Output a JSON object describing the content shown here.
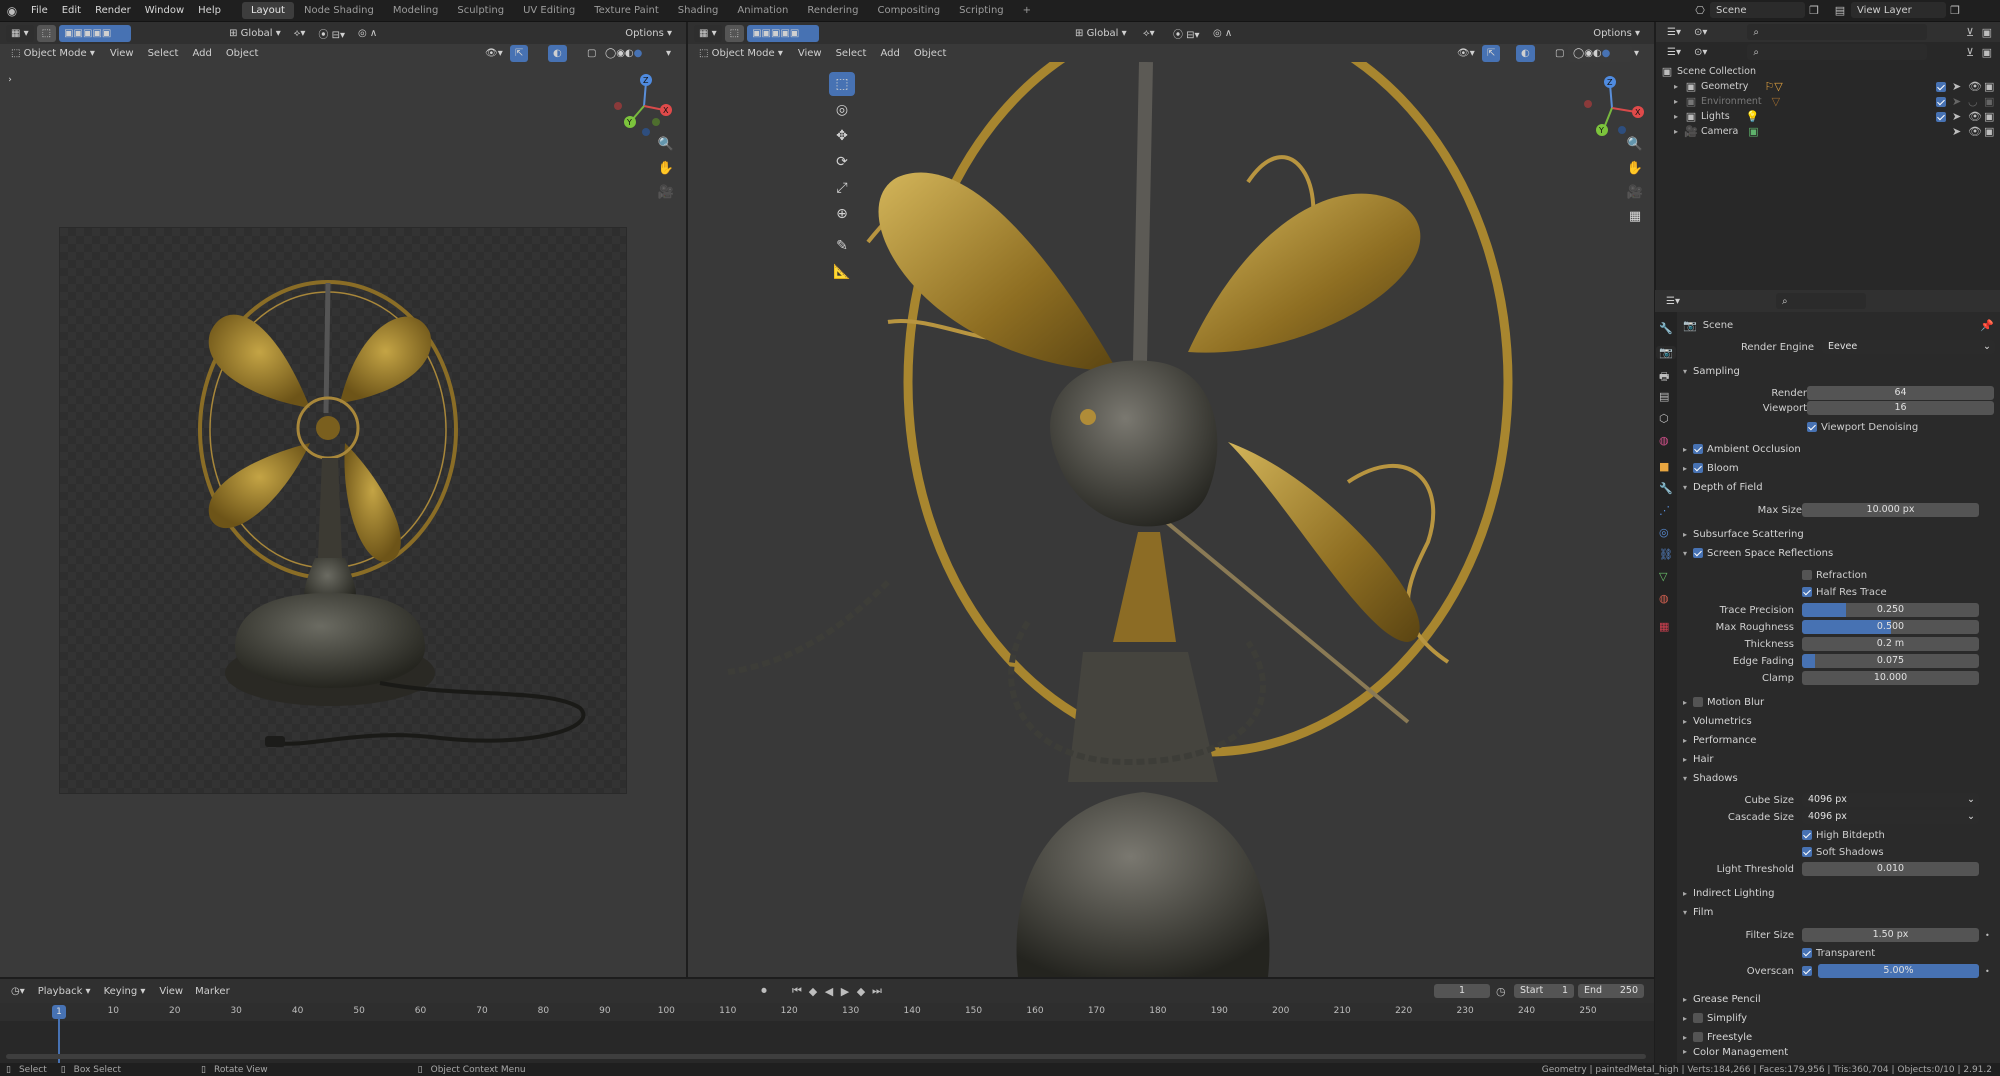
{
  "topbar": {
    "menus": [
      "File",
      "Edit",
      "Render",
      "Window",
      "Help"
    ],
    "workspaces": [
      "Layout",
      "Node Shading",
      "Modeling",
      "Sculpting",
      "UV Editing",
      "Texture Paint",
      "Shading",
      "Animation",
      "Rendering",
      "Compositing",
      "Scripting"
    ],
    "active_workspace": "Layout",
    "add_tab": "+",
    "scene": "Scene",
    "view_layer": "View Layer"
  },
  "left_viewport": {
    "orientation": "Global",
    "options": "Options",
    "mode": "Object Mode",
    "menus": [
      "View",
      "Select",
      "Add",
      "Object"
    ]
  },
  "right_viewport": {
    "orientation": "Global",
    "options": "Options",
    "mode": "Object Mode",
    "menus": [
      "View",
      "Select",
      "Add",
      "Object"
    ]
  },
  "outliner": {
    "root": "Scene Collection",
    "items": [
      {
        "name": "Geometry",
        "dim": false
      },
      {
        "name": "Environment",
        "dim": true
      },
      {
        "name": "Lights",
        "dim": false
      },
      {
        "name": "Camera",
        "dim": false
      }
    ]
  },
  "properties": {
    "title": "Scene",
    "render_engine_label": "Render Engine",
    "render_engine": "Eevee",
    "sampling": {
      "title": "Sampling",
      "render_label": "Render",
      "render": "64",
      "viewport_label": "Viewport",
      "viewport": "16",
      "denoise": "Viewport Denoising"
    },
    "ambient_occlusion": "Ambient Occlusion",
    "bloom": "Bloom",
    "dof": {
      "title": "Depth of Field",
      "max_size_label": "Max Size",
      "max_size": "10.000 px"
    },
    "sss": "Subsurface Scattering",
    "ssr": {
      "title": "Screen Space Reflections",
      "refraction": "Refraction",
      "half_res": "Half Res Trace",
      "trace_precision_label": "Trace Precision",
      "trace_precision": "0.250",
      "trace_precision_frac": 0.25,
      "max_roughness_label": "Max Roughness",
      "max_roughness": "0.500",
      "max_roughness_frac": 0.5,
      "thickness_label": "Thickness",
      "thickness": "0.2 m",
      "edge_fading_label": "Edge Fading",
      "edge_fading": "0.075",
      "edge_fading_frac": 0.075,
      "clamp_label": "Clamp",
      "clamp": "10.000"
    },
    "motion_blur": "Motion Blur",
    "volumetrics": "Volumetrics",
    "performance": "Performance",
    "hair": "Hair",
    "shadows": {
      "title": "Shadows",
      "cube_size_label": "Cube Size",
      "cube_size": "4096 px",
      "cascade_size_label": "Cascade Size",
      "cascade_size": "4096 px",
      "high_bitdepth": "High Bitdepth",
      "soft_shadows": "Soft Shadows",
      "light_threshold_label": "Light Threshold",
      "light_threshold": "0.010"
    },
    "indirect_lighting": "Indirect Lighting",
    "film": {
      "title": "Film",
      "filter_size_label": "Filter Size",
      "filter_size": "1.50 px",
      "transparent": "Transparent",
      "overscan_label": "Overscan",
      "overscan": "5.00%",
      "overscan_frac": 0.05
    },
    "grease_pencil": "Grease Pencil",
    "simplify": "Simplify",
    "freestyle": "Freestyle",
    "color_management": "Color Management"
  },
  "timeline": {
    "menus": [
      "Playback",
      "Keying",
      "View",
      "Marker"
    ],
    "current_frame": "1",
    "start_label": "Start",
    "start": "1",
    "end_label": "End",
    "end": "250",
    "current_marker": "1",
    "ticks": [
      "10",
      "20",
      "30",
      "40",
      "50",
      "60",
      "70",
      "80",
      "90",
      "100",
      "110",
      "120",
      "130",
      "140",
      "150",
      "160",
      "170",
      "180",
      "190",
      "200",
      "210",
      "220",
      "230",
      "240",
      "250"
    ]
  },
  "statusbar": {
    "select": "Select",
    "box_select": "Box Select",
    "rotate_view": "Rotate View",
    "context_menu": "Object Context Menu",
    "stats": "Geometry | paintedMetal_high | Verts:184,266 | Faces:179,956 | Tris:360,704 | Objects:0/10 | 2.91.2"
  },
  "colors": {
    "accent": "#4772b3",
    "header": "#303030",
    "panel": "#2a2a2a",
    "viewport": "#3a3a3a"
  }
}
